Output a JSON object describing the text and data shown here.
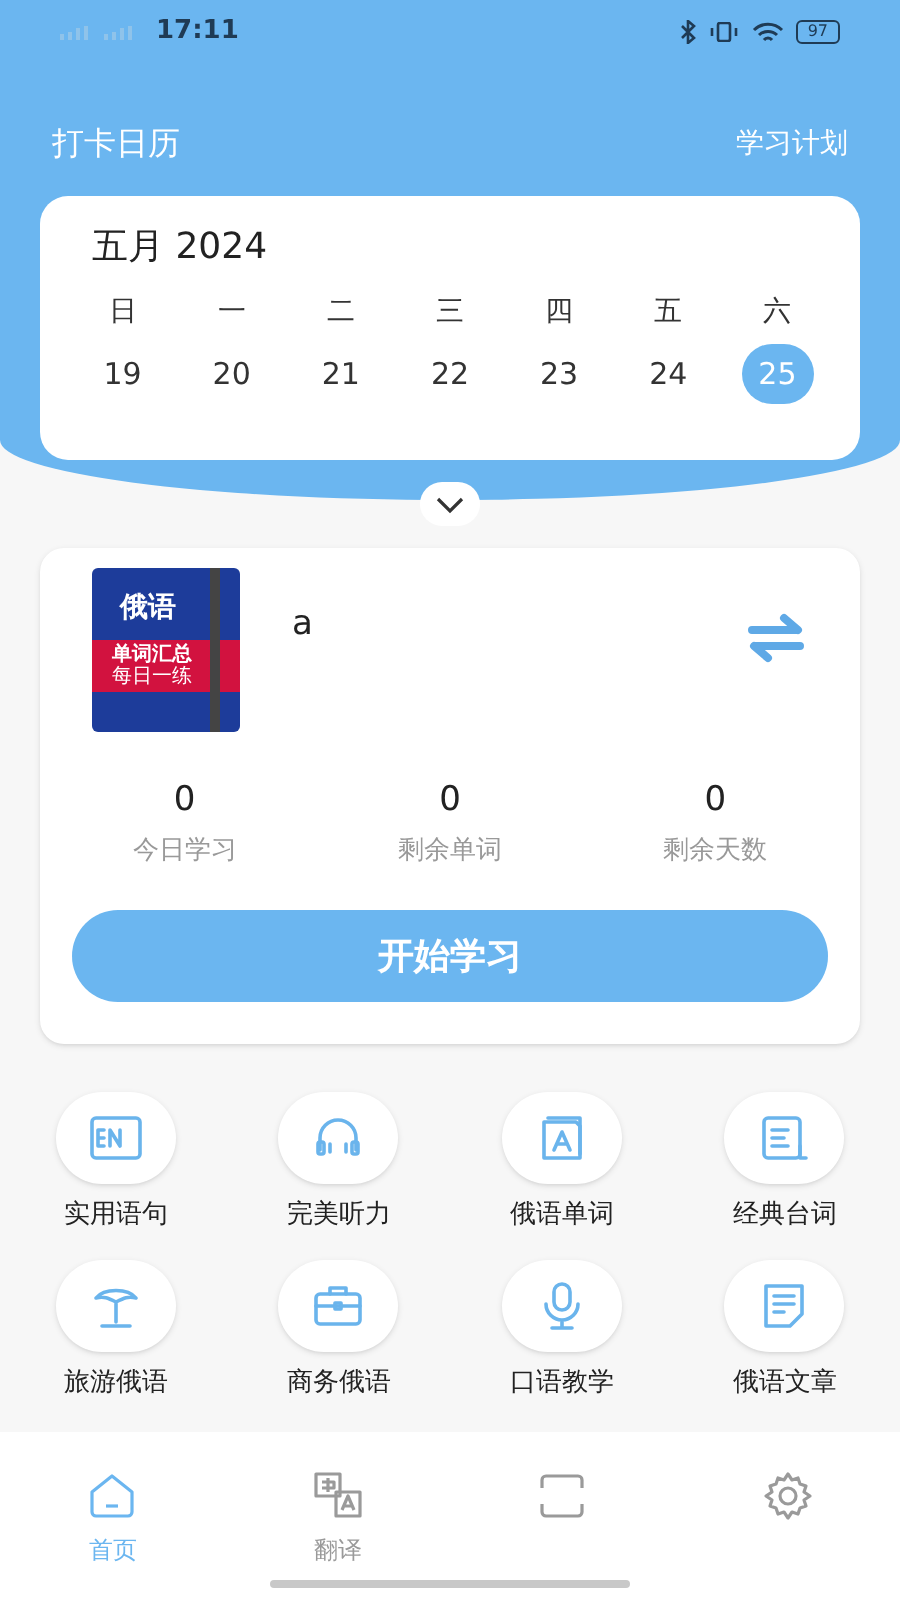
{
  "status_bar": {
    "time": "17:11",
    "battery": "97"
  },
  "header": {
    "title": "打卡日历",
    "plan_link": "学习计划"
  },
  "calendar": {
    "month": "五月 2024",
    "days": [
      {
        "weekday": "日",
        "date": "19",
        "selected": false
      },
      {
        "weekday": "一",
        "date": "20",
        "selected": false
      },
      {
        "weekday": "二",
        "date": "21",
        "selected": false
      },
      {
        "weekday": "三",
        "date": "22",
        "selected": false
      },
      {
        "weekday": "四",
        "date": "23",
        "selected": false
      },
      {
        "weekday": "五",
        "date": "24",
        "selected": false
      },
      {
        "weekday": "六",
        "date": "25",
        "selected": true
      }
    ]
  },
  "book": {
    "cover_title": "俄语",
    "cover_band": "单词汇总",
    "cover_sub": "每日一练",
    "name": "a",
    "stats": [
      {
        "value": "0",
        "label": "今日学习"
      },
      {
        "value": "0",
        "label": "剩余单词"
      },
      {
        "value": "0",
        "label": "剩余天数"
      }
    ],
    "start_button": "开始学习"
  },
  "features": [
    {
      "kind": "en",
      "label": "实用语句"
    },
    {
      "kind": "headphones",
      "label": "完美听力"
    },
    {
      "kind": "book",
      "label": "俄语单词"
    },
    {
      "kind": "doc",
      "label": "经典台词"
    },
    {
      "kind": "palm",
      "label": "旅游俄语"
    },
    {
      "kind": "briefcase",
      "label": "商务俄语"
    },
    {
      "kind": "mic",
      "label": "口语教学"
    },
    {
      "kind": "note",
      "label": "俄语文章"
    }
  ],
  "tabs": [
    {
      "kind": "home",
      "label": "首页",
      "selected": true
    },
    {
      "kind": "translate",
      "label": "翻译",
      "selected": false
    },
    {
      "kind": "scan",
      "selected": false
    },
    {
      "kind": "gear",
      "selected": false
    }
  ]
}
